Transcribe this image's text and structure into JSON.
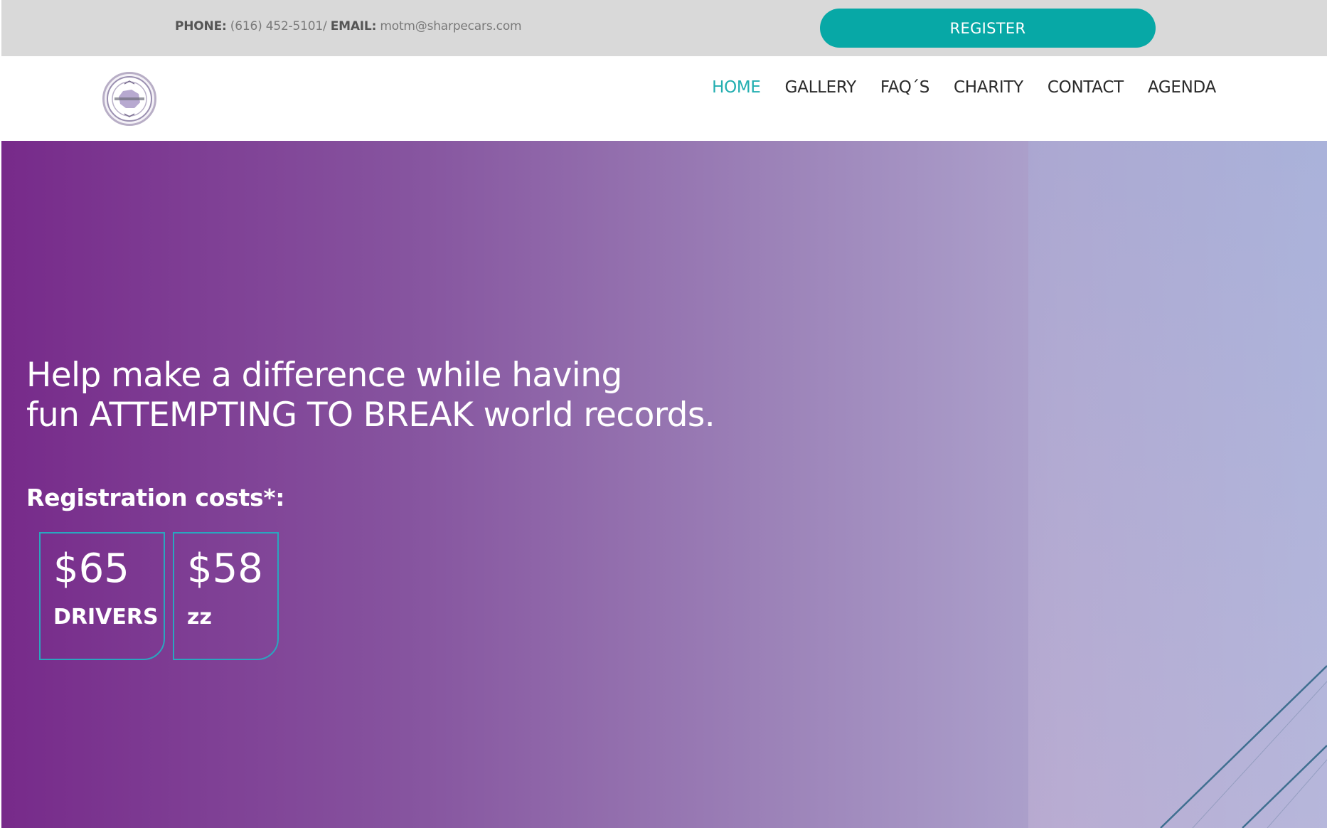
{
  "topbar": {
    "phone_label": "PHONE:",
    "phone_value": "(616) 452-5101/",
    "email_label": "EMAIL:",
    "email_value": "motm@sharpecars.com",
    "register_label": "REGISTER"
  },
  "navbar": {
    "logo_icon": "circular-seal-logo",
    "items": [
      {
        "label": "HOME",
        "active": true
      },
      {
        "label": "GALLERY"
      },
      {
        "label": "FAQ´S"
      },
      {
        "label": "CHARITY"
      },
      {
        "label": "CONTACT"
      },
      {
        "label": "AGENDA"
      }
    ],
    "active_color": "#22aeb0"
  },
  "hero": {
    "headline_line1": "Help make a difference while having",
    "headline_line2": "fun ATTEMPTING TO BREAK world records.",
    "registration_label": "Registration costs*:",
    "prices": [
      {
        "amount": "$65",
        "tier": "DRIVERS"
      },
      {
        "amount": "$58",
        "tier": "zz"
      }
    ],
    "gradient_colors": [
      "#772a8a",
      "#8756a0",
      "#9c82b8",
      "#ada3cd",
      "#aab1d9"
    ],
    "card_border_color": "#2aa6bf"
  },
  "colors": {
    "topbar_bg": "#d9d9d9",
    "register_bg": "#07a8a6",
    "nav_text": "#2b2b2b"
  }
}
